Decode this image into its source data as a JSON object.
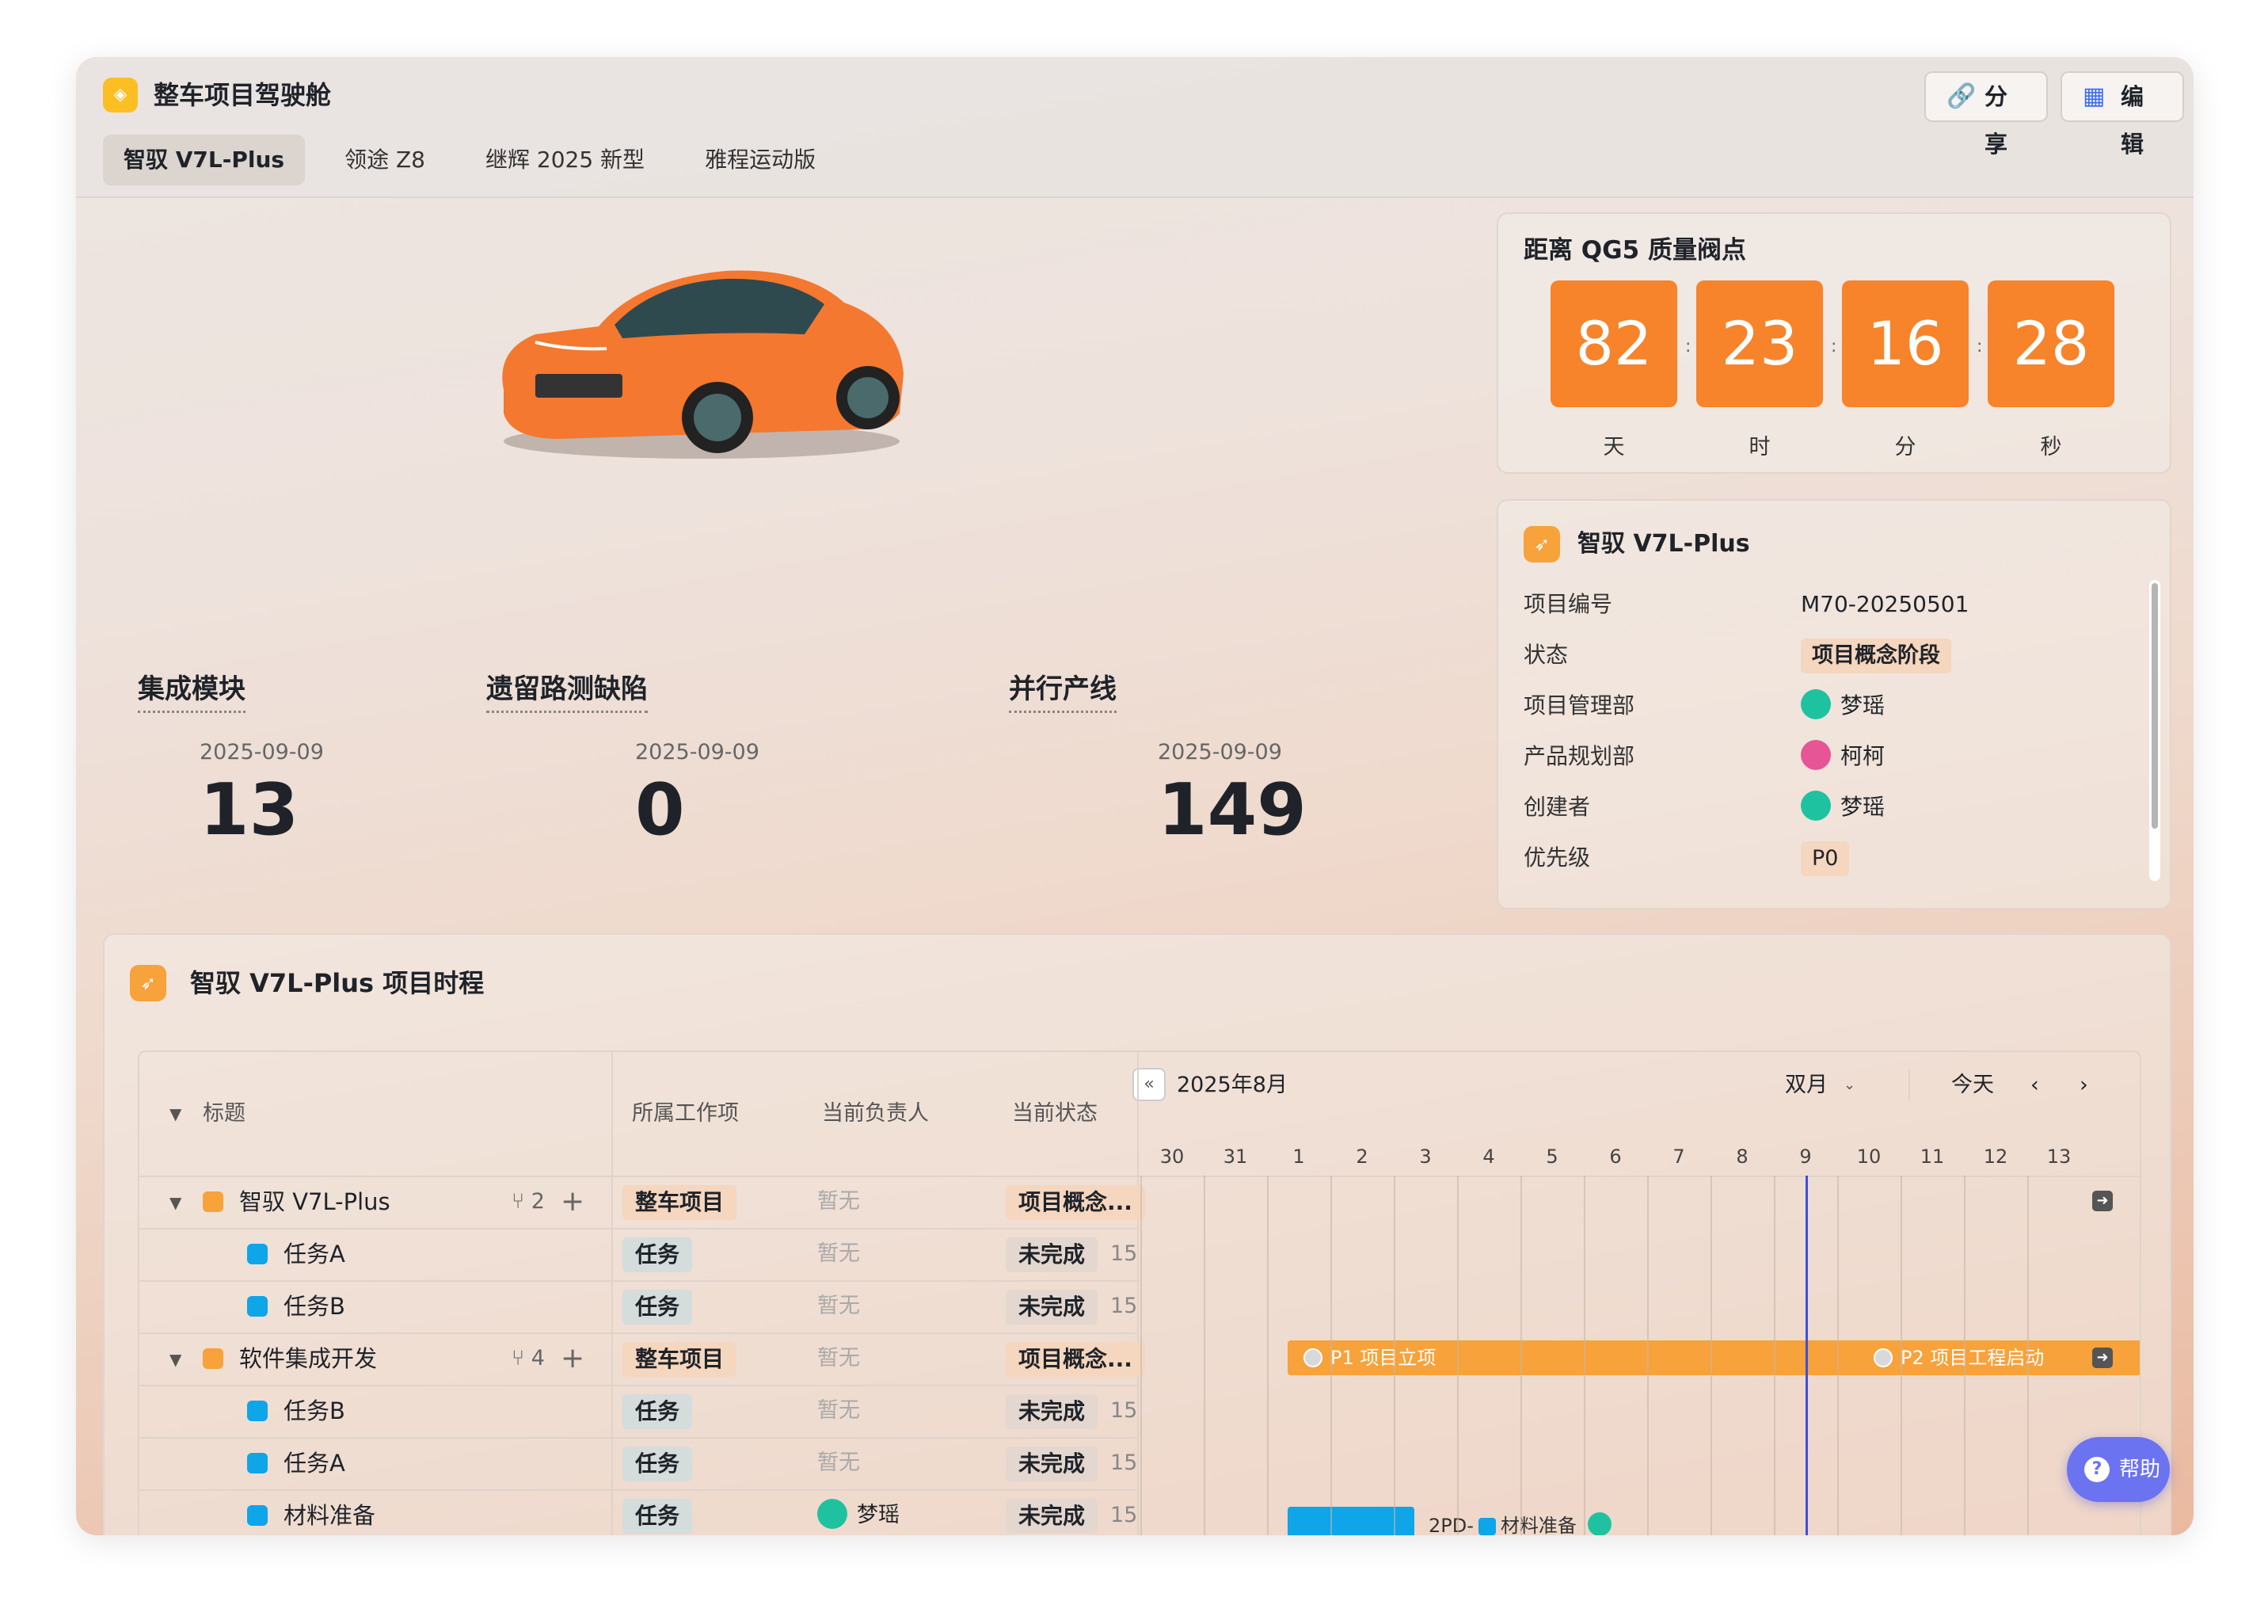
{
  "app": {
    "title": "整车项目驾驶舱",
    "share_label": "分享",
    "edit_label": "编辑"
  },
  "tabs": [
    {
      "label": "智驭 V7L-Plus"
    },
    {
      "label": "领途 Z8"
    },
    {
      "label": "继辉 2025 新型"
    },
    {
      "label": "雅程运动版"
    }
  ],
  "metrics": [
    {
      "label": "集成模块",
      "date": "2025-09-09",
      "value": "13"
    },
    {
      "label": "遗留路测缺陷",
      "date": "2025-09-09",
      "value": "0"
    },
    {
      "label": "并行产线",
      "date": "2025-09-09",
      "value": "149"
    }
  ],
  "countdown": {
    "title": "距离 QG5 质量阀点",
    "days": "82",
    "hours": "23",
    "minutes": "16",
    "seconds": "28",
    "sep": ":",
    "units": {
      "days": "天",
      "hours": "时",
      "minutes": "分",
      "seconds": "秒"
    }
  },
  "info": {
    "title": "智驭 V7L-Plus",
    "rows": [
      {
        "key": "项目编号",
        "value": "M70-20250501"
      },
      {
        "key": "状态",
        "value": "项目概念阶段"
      },
      {
        "key": "项目管理部",
        "value": "梦瑶"
      },
      {
        "key": "产品规划部",
        "value": "柯柯"
      },
      {
        "key": "创建者",
        "value": "梦瑶"
      },
      {
        "key": "优先级",
        "value": "P0"
      }
    ]
  },
  "timeline": {
    "title": "智驭 V7L-Plus 项目时程",
    "headers": {
      "title": "标题",
      "work": "所属工作项",
      "owner": "当前负责人",
      "status": "当前状态"
    },
    "month": "2025年8月",
    "view": "双月",
    "today_label": "今天",
    "days": [
      "30",
      "31",
      "1",
      "2",
      "3",
      "4",
      "5",
      "6",
      "7",
      "8",
      "9",
      "10",
      "11",
      "12",
      "13"
    ],
    "rows": [
      {
        "name": "智驭 V7L-Plus",
        "count": "2",
        "work": "整车项目",
        "owner": "暂无",
        "status": "项目概念...",
        "num": ""
      },
      {
        "name": "任务A",
        "count": "",
        "work": "任务",
        "owner": "暂无",
        "status": "未完成",
        "num": "15"
      },
      {
        "name": "任务B",
        "count": "",
        "work": "任务",
        "owner": "暂无",
        "status": "未完成",
        "num": "15"
      },
      {
        "name": "软件集成开发",
        "count": "4",
        "work": "整车项目",
        "owner": "暂无",
        "status": "项目概念...",
        "num": ""
      },
      {
        "name": "任务B",
        "count": "",
        "work": "任务",
        "owner": "暂无",
        "status": "未完成",
        "num": "15"
      },
      {
        "name": "任务A",
        "count": "",
        "work": "任务",
        "owner": "暂无",
        "status": "未完成",
        "num": "15"
      },
      {
        "name": "材料准备",
        "count": "",
        "work": "任务",
        "owner": "梦瑶",
        "status": "未完成",
        "num": "15"
      }
    ],
    "milestones": {
      "m1": "P1 项目立项",
      "m2": "P2 项目工程启动"
    },
    "task_bar_label": "2PD-",
    "task_bar_name": "材料准备"
  },
  "help_label": "帮助",
  "colors": {
    "accent": "#f7832a",
    "today_line": "#3b4fe0",
    "task_blue": "#0ea5e9",
    "help": "#6b73f0"
  }
}
